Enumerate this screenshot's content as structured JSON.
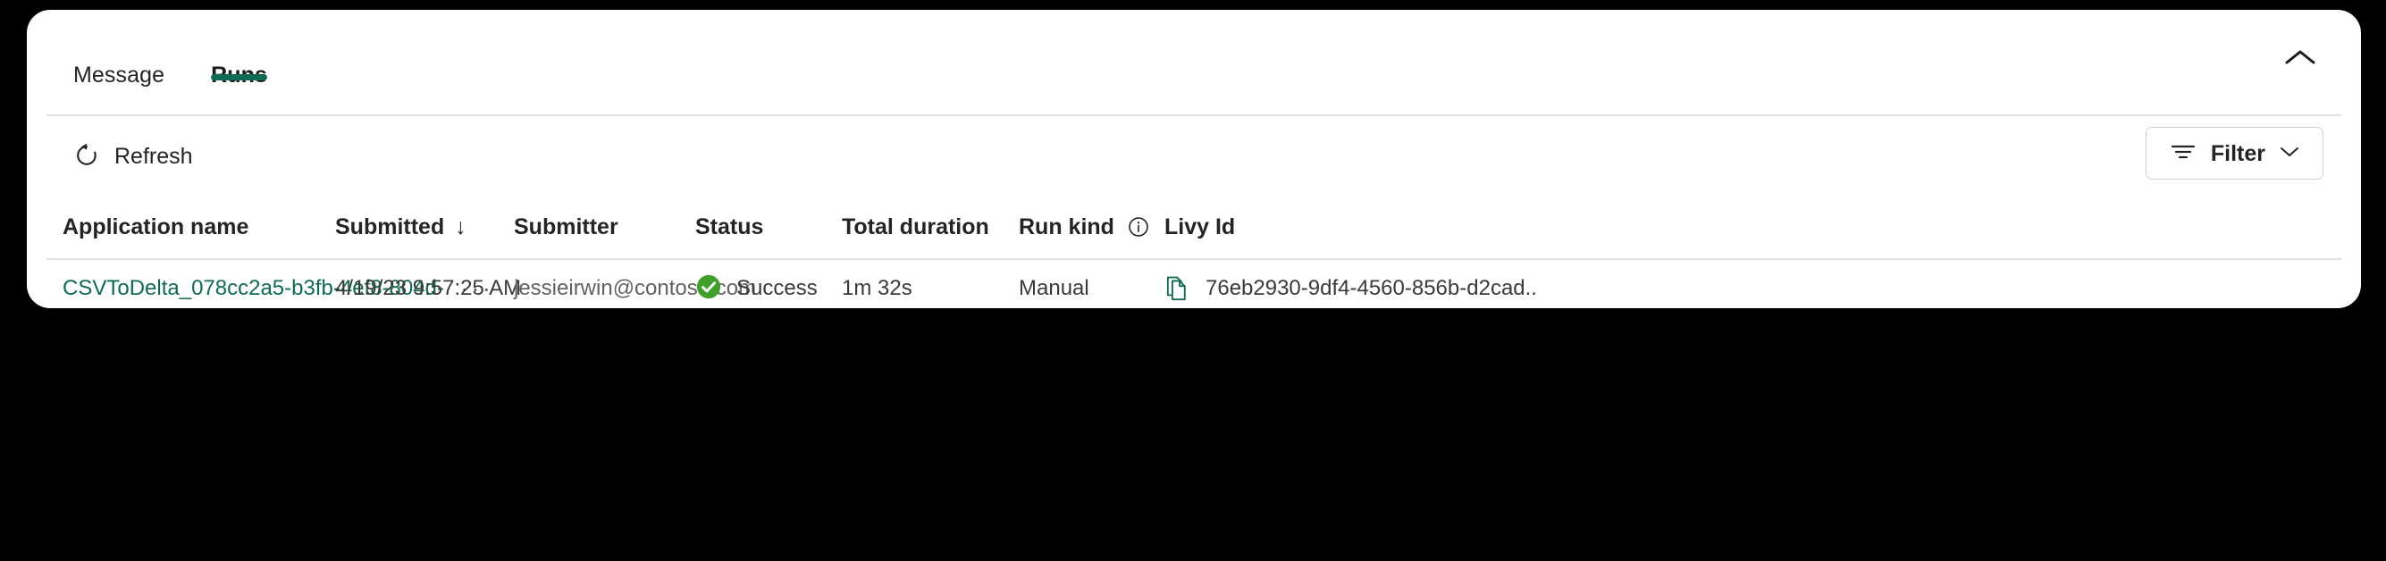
{
  "panel": {
    "collapse_icon": "chevron-up-icon"
  },
  "tabs": [
    {
      "label": "Message",
      "active": false
    },
    {
      "label": "Runs",
      "active": true
    }
  ],
  "toolbar": {
    "refresh_label": "Refresh",
    "refresh_icon": "refresh-circular-arrow-icon",
    "filter_label": "Filter",
    "filter_icon": "filter-lines-icon",
    "filter_chevron_icon": "chevron-down-icon"
  },
  "table": {
    "columns": [
      {
        "label": "Application name",
        "sort": ""
      },
      {
        "label": "Submitted",
        "sort": "↓"
      },
      {
        "label": "Submitter",
        "sort": ""
      },
      {
        "label": "Status",
        "sort": ""
      },
      {
        "label": "Total duration",
        "sort": ""
      },
      {
        "label": "Run kind",
        "sort": "",
        "info_icon": "info-circle-icon"
      },
      {
        "label": "Livy Id",
        "sort": ""
      }
    ],
    "rows": [
      {
        "application_name": "CSVToDelta_078cc2a5-b3fb-4ef8-804d-",
        "more_actions": "···",
        "submitted": "4/19/23 9:57:25 AM",
        "submitter": "jessieirwin@contoso.com",
        "status": "Success",
        "status_icon": "success-check-circle-icon",
        "total_duration": "1m 32s",
        "run_kind": "Manual",
        "livy_id": "76eb2930-9df4-4560-856b-d2cad..",
        "livy_copy_icon": "copy-document-icon"
      }
    ]
  },
  "colors": {
    "accent_green": "#0f6b53",
    "success_green": "#3fa12a",
    "text_primary": "#242424",
    "text_secondary": "#616161",
    "border": "#e0e0e0",
    "card_background": "#ffffff",
    "page_background": "#000000"
  }
}
